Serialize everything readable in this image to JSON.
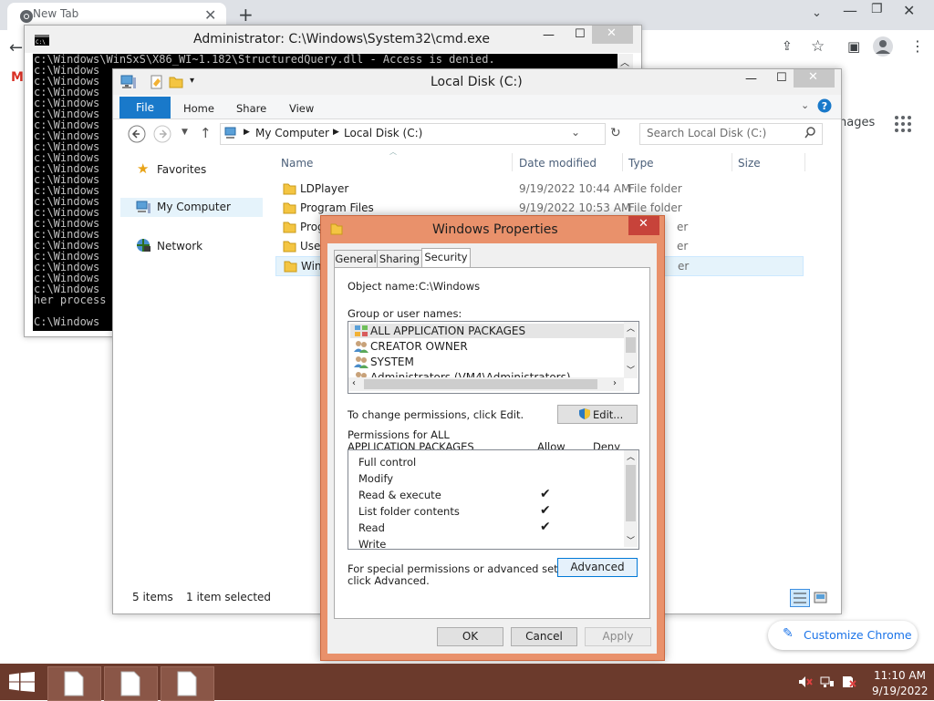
{
  "chrome": {
    "tab_title": "New Tab",
    "images_label": "nages",
    "customize_label": "Customize Chrome"
  },
  "cmd": {
    "title": "Administrator: C:\\Windows\\System32\\cmd.exe",
    "lines": [
      "c:\\Windows\\WinSxS\\X86_WI~1.182\\StructuredQuery.dll - Access is denied.",
      "c:\\Windows",
      "c:\\Windows",
      "c:\\Windows",
      "c:\\Windows",
      "c:\\Windows",
      "c:\\Windows",
      "c:\\Windows",
      "c:\\Windows",
      "c:\\Windows",
      "c:\\Windows",
      "c:\\Windows",
      "c:\\Windows",
      "c:\\Windows",
      "c:\\Windows",
      "c:\\Windows",
      "c:\\Windows",
      "c:\\Windows",
      "c:\\Windows",
      "c:\\Windows",
      "c:\\Windows",
      "c:\\Windows",
      "her process",
      "",
      "C:\\Windows"
    ]
  },
  "explorer": {
    "title": "Local Disk (C:)",
    "ribbon_tabs": [
      "File",
      "Home",
      "Share",
      "View"
    ],
    "breadcrumb": [
      "My Computer",
      "Local Disk (C:)"
    ],
    "search_placeholder": "Search Local Disk (C:)",
    "nav": [
      "Favorites",
      "My Computer",
      "Network"
    ],
    "columns": [
      "Name",
      "Date modified",
      "Type",
      "Size"
    ],
    "files": [
      {
        "name": "LDPlayer",
        "date": "9/19/2022 10:44 AM",
        "type": "File folder"
      },
      {
        "name": "Program Files",
        "date": "9/19/2022 10:53 AM",
        "type": "File folder"
      },
      {
        "name": "Prog",
        "date": "",
        "type": "er"
      },
      {
        "name": "User",
        "date": "",
        "type": "er"
      },
      {
        "name": "Wind",
        "date": "",
        "type": "er"
      }
    ],
    "status_count": "5 items",
    "status_selected": "1 item selected"
  },
  "props": {
    "title": "Windows Properties",
    "tabs": [
      "General",
      "Sharing",
      "Security"
    ],
    "object_label": "Object name:",
    "object_value": "C:\\Windows",
    "groups_label": "Group or user names:",
    "groups": [
      "ALL APPLICATION PACKAGES",
      "CREATOR OWNER",
      "SYSTEM",
      "Administrators (VM4\\Administrators)"
    ],
    "change_text": "To change permissions, click Edit.",
    "edit_button": "Edit...",
    "perm_for_line1": "Permissions for ALL",
    "perm_for_line2": "APPLICATION PACKAGES",
    "allow_label": "Allow",
    "deny_label": "Deny",
    "permissions": [
      {
        "name": "Full control",
        "allow": false
      },
      {
        "name": "Modify",
        "allow": false
      },
      {
        "name": "Read & execute",
        "allow": true
      },
      {
        "name": "List folder contents",
        "allow": true
      },
      {
        "name": "Read",
        "allow": true
      },
      {
        "name": "Write",
        "allow": false
      }
    ],
    "special_line1": "For special permissions or advanced settings,",
    "special_line2": "click Advanced.",
    "advanced_button": "Advanced",
    "ok_button": "OK",
    "cancel_button": "Cancel",
    "apply_button": "Apply"
  },
  "taskbar": {
    "time": "11:10 AM",
    "date": "9/19/2022"
  }
}
